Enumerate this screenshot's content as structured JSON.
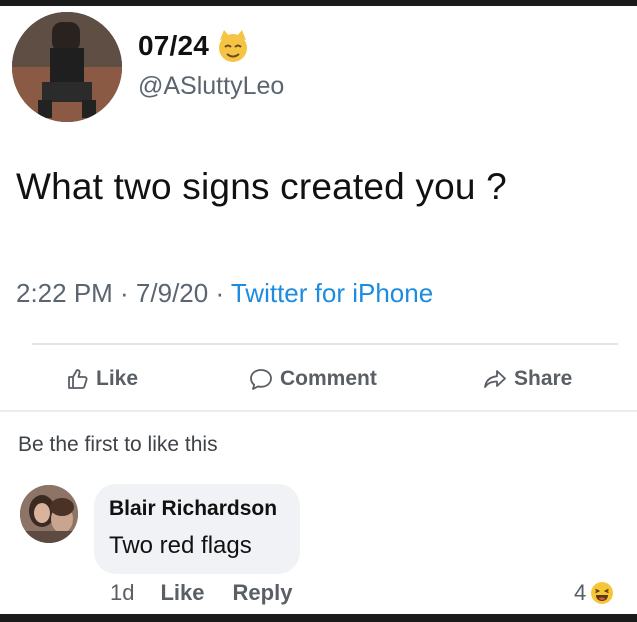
{
  "tweet": {
    "display_name": "07/24",
    "handle": "@ASluttyLeo",
    "text": "What two signs created you ?",
    "time": "2:22 PM · 7/9/20 · ",
    "source": "Twitter for iPhone"
  },
  "actions": {
    "like": "Like",
    "comment": "Comment",
    "share": "Share"
  },
  "likes_summary": "Be the first to like this",
  "comment": {
    "author": "Blair Richardson",
    "text": "Two red flags",
    "age": "1d",
    "like": "Like",
    "reply": "Reply",
    "reaction_count": "4"
  },
  "icons": {
    "name_emoji": "smirking-cat-emoji-icon",
    "like": "thumbs-up-icon",
    "comment": "speech-bubble-icon",
    "share": "share-arrow-icon",
    "reaction": "haha-reaction-icon"
  },
  "colors": {
    "link_blue": "#1d8ce0",
    "meta_gray": "#5b6570"
  }
}
